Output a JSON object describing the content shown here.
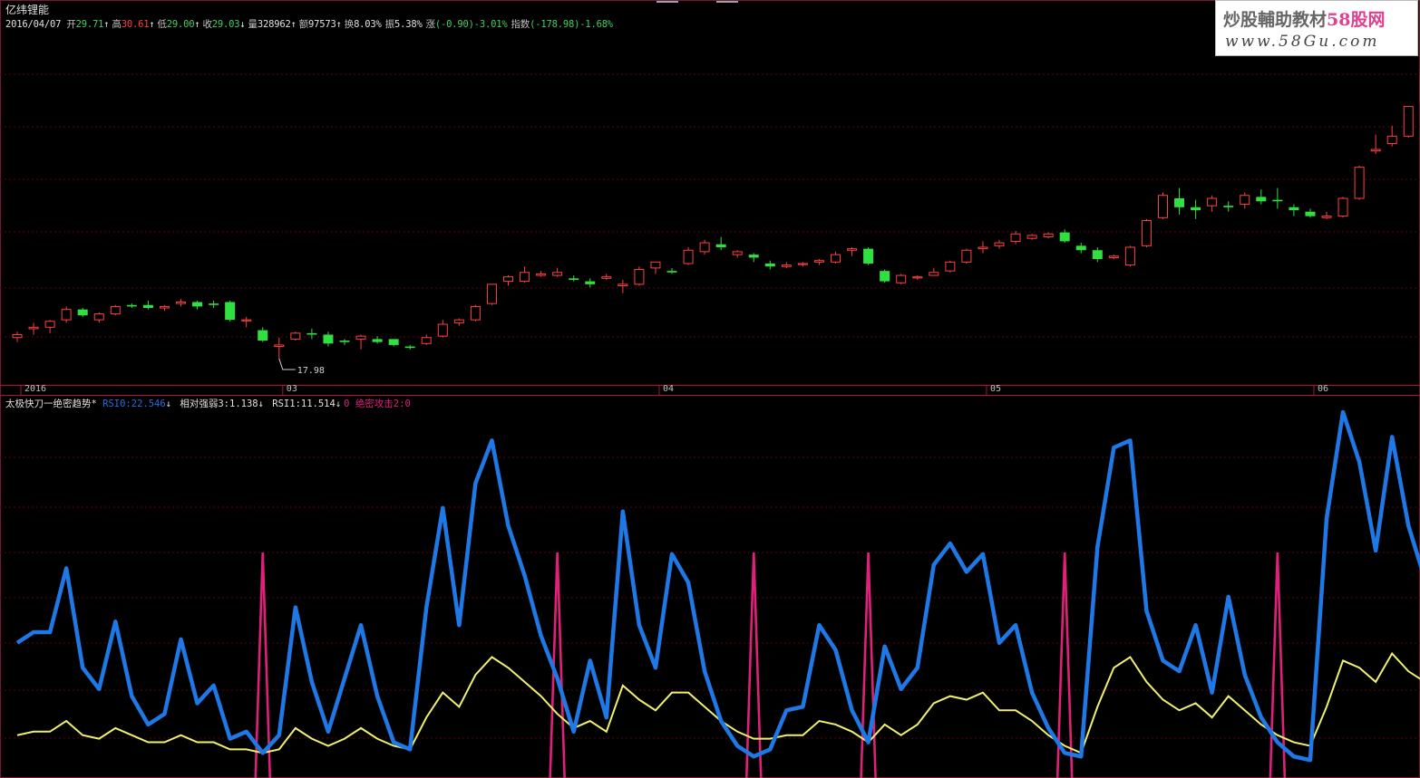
{
  "stock": {
    "name": "亿纬锂能",
    "date": "2016/04/07",
    "quote": [
      {
        "label": "开",
        "value": "29.71",
        "cls": "dn",
        "arrow": "↑"
      },
      {
        "label": "高",
        "value": "30.61",
        "cls": "up",
        "arrow": "↑"
      },
      {
        "label": "低",
        "value": "29.00",
        "cls": "dn",
        "arrow": "↑"
      },
      {
        "label": "收",
        "value": "29.03",
        "cls": "dn",
        "arrow": "↓"
      },
      {
        "label": "量",
        "value": "328962",
        "cls": "wt",
        "arrow": "↑"
      },
      {
        "label": "额",
        "value": "97573",
        "cls": "wt",
        "arrow": "↑"
      },
      {
        "label": "换",
        "value": "8.03%",
        "cls": "wt",
        "arrow": ""
      },
      {
        "label": "振",
        "value": "5.38%",
        "cls": "wt",
        "arrow": ""
      },
      {
        "label": "涨",
        "value": "(-0.90)-3.01%",
        "cls": "dn",
        "arrow": ""
      },
      {
        "label": "指数",
        "value": "(-178.98)-1.68%",
        "cls": "dn",
        "arrow": ""
      }
    ],
    "low_marker": "17.98"
  },
  "watermark": {
    "title_a": "炒股輔助教材",
    "title_b": "58股网",
    "url": "www.58Gu.com"
  },
  "date_axis": [
    {
      "label": "2016",
      "index": 0
    },
    {
      "label": "03",
      "index": 16
    },
    {
      "label": "04",
      "index": 39
    },
    {
      "label": "05",
      "index": 59
    },
    {
      "label": "06",
      "index": 79
    }
  ],
  "indicator": {
    "title": "太极快刀一绝密趋势*",
    "rsi0_label": "RSI0:",
    "rsi0_value": "22.546",
    "rsi0_arrow": "↓",
    "rel_label": "相对强弱3:",
    "rel_value": "1.138",
    "rel_arrow": "↓",
    "rsi1_label": "RSI1:",
    "rsi1_value": "11.514",
    "rsi1_arrow": "↓",
    "rsi1_suffix": "0",
    "attack_label": "绝密攻击2:",
    "attack_value": "0"
  },
  "colors": {
    "up": "#ff4040",
    "down": "#30e040",
    "rsi0": "#1e78e6",
    "rsi1": "#f0f070",
    "attack": "#e0207a",
    "grid": "#600010"
  },
  "chart_data": [
    {
      "type": "candlestick",
      "ylim": [
        17,
        32
      ],
      "candles": [
        [
          19.4,
          19.8,
          19.1,
          19.6
        ],
        [
          20.0,
          20.4,
          19.6,
          20.1
        ],
        [
          20.1,
          20.6,
          19.7,
          20.5
        ],
        [
          20.6,
          21.5,
          20.4,
          21.3
        ],
        [
          21.3,
          21.4,
          20.8,
          20.9
        ],
        [
          20.6,
          21.1,
          20.4,
          21.0
        ],
        [
          21.0,
          21.6,
          20.9,
          21.5
        ],
        [
          21.6,
          21.7,
          21.4,
          21.5
        ],
        [
          21.6,
          21.9,
          21.3,
          21.4
        ],
        [
          21.4,
          21.6,
          21.2,
          21.5
        ],
        [
          21.7,
          22.0,
          21.5,
          21.8
        ],
        [
          21.8,
          21.9,
          21.3,
          21.5
        ],
        [
          21.7,
          21.9,
          21.4,
          21.6
        ],
        [
          21.8,
          21.9,
          20.5,
          20.6
        ],
        [
          20.6,
          20.8,
          20.1,
          20.6
        ],
        [
          19.9,
          20.1,
          19.1,
          19.2
        ],
        [
          18.8,
          19.4,
          17.98,
          18.9
        ],
        [
          19.3,
          19.8,
          19.2,
          19.7
        ],
        [
          19.7,
          20.0,
          19.3,
          19.6
        ],
        [
          19.6,
          19.8,
          18.8,
          19.0
        ],
        [
          19.2,
          19.3,
          18.9,
          19.1
        ],
        [
          19.3,
          19.6,
          18.6,
          19.5
        ],
        [
          19.3,
          19.5,
          19.0,
          19.1
        ],
        [
          19.3,
          19.3,
          18.8,
          18.9
        ],
        [
          18.8,
          18.9,
          18.6,
          18.7
        ],
        [
          19.0,
          19.6,
          18.9,
          19.4
        ],
        [
          19.5,
          20.6,
          19.4,
          20.3
        ],
        [
          20.4,
          20.7,
          20.2,
          20.6
        ],
        [
          20.6,
          21.6,
          20.5,
          21.5
        ],
        [
          21.7,
          23.0,
          21.6,
          23.0
        ],
        [
          23.2,
          23.6,
          22.9,
          23.5
        ],
        [
          23.2,
          24.2,
          23.1,
          23.8
        ],
        [
          23.6,
          23.9,
          23.5,
          23.7
        ],
        [
          23.6,
          24.1,
          23.5,
          23.8
        ],
        [
          23.4,
          23.6,
          23.2,
          23.3
        ],
        [
          23.2,
          23.4,
          22.8,
          23.0
        ],
        [
          23.4,
          23.7,
          23.3,
          23.5
        ],
        [
          22.9,
          23.3,
          22.4,
          23.0
        ],
        [
          23.0,
          24.2,
          22.9,
          24.0
        ],
        [
          24.1,
          24.3,
          23.7,
          24.5
        ],
        [
          23.9,
          24.1,
          23.7,
          23.8
        ],
        [
          24.4,
          25.5,
          24.3,
          25.3
        ],
        [
          25.2,
          26.0,
          25.0,
          25.8
        ],
        [
          25.7,
          26.2,
          25.3,
          25.5
        ],
        [
          25.0,
          25.3,
          24.8,
          25.2
        ],
        [
          25.0,
          25.1,
          24.5,
          24.8
        ],
        [
          24.4,
          24.6,
          24.0,
          24.2
        ],
        [
          24.2,
          24.5,
          24.1,
          24.3
        ],
        [
          24.4,
          24.5,
          24.2,
          24.4
        ],
        [
          24.5,
          24.7,
          24.3,
          24.6
        ],
        [
          24.5,
          25.2,
          24.4,
          25.0
        ],
        [
          25.3,
          25.5,
          24.9,
          25.4
        ],
        [
          25.4,
          25.5,
          24.3,
          24.4
        ],
        [
          23.9,
          24.0,
          23.1,
          23.2
        ],
        [
          23.1,
          23.7,
          23.0,
          23.6
        ],
        [
          23.5,
          23.6,
          23.3,
          23.5
        ],
        [
          23.6,
          24.1,
          23.6,
          23.8
        ],
        [
          23.9,
          24.6,
          23.8,
          24.5
        ],
        [
          24.5,
          25.4,
          24.4,
          25.3
        ],
        [
          25.4,
          25.9,
          25.1,
          25.5
        ],
        [
          25.6,
          26.0,
          25.4,
          25.8
        ],
        [
          25.9,
          26.6,
          25.7,
          26.4
        ],
        [
          26.1,
          26.4,
          26.0,
          26.3
        ],
        [
          26.2,
          26.5,
          26.1,
          26.4
        ],
        [
          26.5,
          26.7,
          25.8,
          25.9
        ],
        [
          25.6,
          25.8,
          25.1,
          25.3
        ],
        [
          25.3,
          25.5,
          24.5,
          24.7
        ],
        [
          24.8,
          25.0,
          24.7,
          24.9
        ],
        [
          24.3,
          25.6,
          24.2,
          25.5
        ],
        [
          25.6,
          27.4,
          25.5,
          27.3
        ],
        [
          27.5,
          29.2,
          27.4,
          29.0
        ],
        [
          28.8,
          29.5,
          27.7,
          28.2
        ],
        [
          28.2,
          28.7,
          27.4,
          28.0
        ],
        [
          28.3,
          29.0,
          27.9,
          28.8
        ],
        [
          28.3,
          28.6,
          27.9,
          28.2
        ],
        [
          28.4,
          29.2,
          28.1,
          29.0
        ],
        [
          28.9,
          29.4,
          28.4,
          28.6
        ],
        [
          28.7,
          29.5,
          28.1,
          28.6
        ],
        [
          28.2,
          28.4,
          27.6,
          28.0
        ],
        [
          27.9,
          28.1,
          27.5,
          27.6
        ],
        [
          27.5,
          27.9,
          27.4,
          27.6
        ],
        [
          27.6,
          28.9,
          27.5,
          28.8
        ],
        [
          28.8,
          31.0,
          28.7,
          30.9
        ],
        [
          32.0,
          33.1,
          31.8,
          32.1
        ],
        [
          32.5,
          33.7,
          32.3,
          33.0
        ],
        [
          33.0,
          35.0,
          32.9,
          35.0
        ],
        [
          35.2,
          37.6,
          35.0,
          37.5
        ],
        [
          37.1,
          38.3,
          36.2,
          37.2
        ],
        [
          37.4,
          38.4,
          36.6,
          38.2
        ]
      ]
    },
    {
      "type": "line",
      "ylim": [
        0,
        100
      ],
      "series": [
        {
          "name": "RSI0",
          "values": [
            35,
            38,
            38,
            56,
            28,
            22,
            41,
            20,
            12,
            15,
            36,
            18,
            23,
            8,
            10,
            4,
            9,
            45,
            24,
            10,
            25,
            40,
            20,
            7,
            5,
            45,
            73,
            40,
            80,
            92,
            68,
            54,
            37,
            25,
            10,
            30,
            14,
            72,
            40,
            28,
            60,
            52,
            27,
            13,
            6,
            3,
            5,
            16,
            17,
            40,
            33,
            16,
            7,
            34,
            22,
            28,
            57,
            63,
            55,
            60,
            35,
            40,
            21,
            11,
            4,
            3,
            62,
            90,
            92,
            44,
            30,
            27,
            40,
            21,
            48,
            26,
            14,
            7,
            3,
            2,
            70,
            100,
            86,
            61,
            93,
            68,
            53
          ]
        },
        {
          "name": "RSI1",
          "values": [
            9,
            10,
            10,
            13,
            9,
            8,
            11,
            9,
            7,
            7,
            9,
            7,
            7,
            5,
            5,
            4,
            5,
            11,
            8,
            6,
            8,
            11,
            8,
            6,
            5,
            14,
            21,
            17,
            26,
            31,
            28,
            24,
            20,
            15,
            11,
            13,
            10,
            23,
            19,
            16,
            21,
            21,
            17,
            13,
            10,
            8,
            8,
            9,
            9,
            13,
            12,
            10,
            7,
            12,
            9,
            12,
            18,
            20,
            19,
            21,
            16,
            16,
            13,
            9,
            6,
            4,
            17,
            28,
            31,
            24,
            19,
            16,
            18,
            14,
            20,
            16,
            12,
            9,
            7,
            6,
            17,
            30,
            28,
            24,
            32,
            27,
            24
          ]
        },
        {
          "name": "绝密攻击",
          "spikes": [
            15,
            33,
            45,
            52,
            64,
            77
          ]
        }
      ]
    }
  ]
}
